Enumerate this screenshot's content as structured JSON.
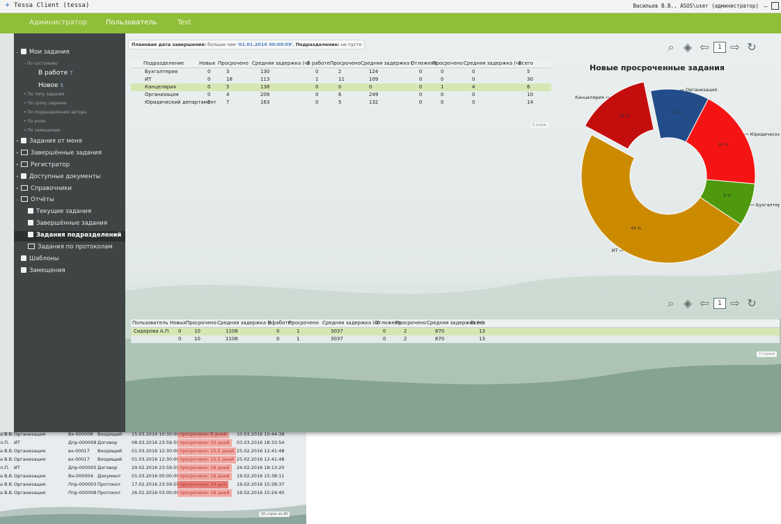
{
  "window": {
    "title": "Tessa Client (tessa)",
    "user": "Васильев В.В., ASUS\\user (администратор)"
  },
  "menu": [
    "Администратор",
    "Пользователь",
    "Test"
  ],
  "sidebar": {
    "my_tasks": "Мои задания",
    "by_state": "По состоянию",
    "in_work": "В работе",
    "in_work_count": "7",
    "new": "Новое",
    "new_count": "5",
    "subs": [
      "По типу задания",
      "По сроку задания",
      "По подразделению автора",
      "По роли",
      "По замещению"
    ],
    "items": [
      "Задания от меня",
      "Завершённые задания",
      "Регистратор",
      "Доступные документы",
      "Справочники",
      "Отчёты"
    ],
    "reports": [
      "Текущие задания",
      "Завершённые задания",
      "Задания подразделений",
      "Задания по протоколам"
    ],
    "bottom": [
      "Шаблоны",
      "Замещения"
    ]
  },
  "filter": {
    "label1": "Плановая дата завершения:",
    "cond1": "больше чем",
    "value1": "'01.01.2016 00:09:09'",
    "label2": "Подразделение:",
    "cond2": "не пусто"
  },
  "table1": {
    "headers": [
      "Подразделение",
      "Новых",
      "Просрочено",
      "Средняя задержка (ч)",
      "В работе",
      "Просрочено",
      "Средняя задержка (",
      "Отложено",
      "Просрочено",
      "Средняя задержка (ч)",
      "Всего"
    ],
    "rows": [
      [
        "Бухгалтерия",
        "0",
        "3",
        "130",
        "0",
        "2",
        "124",
        "0",
        "0",
        "0",
        "5"
      ],
      [
        "ИТ",
        "0",
        "18",
        "113",
        "1",
        "11",
        "109",
        "0",
        "0",
        "0",
        "30"
      ],
      [
        "Канцелярия",
        "0",
        "5",
        "138",
        "0",
        "0",
        "0",
        "0",
        "1",
        "4",
        "6"
      ],
      [
        "Организация",
        "0",
        "4",
        "209",
        "0",
        "6",
        "249",
        "0",
        "0",
        "0",
        "10"
      ],
      [
        "Юридический департамент",
        "2",
        "7",
        "163",
        "0",
        "5",
        "132",
        "0",
        "0",
        "0",
        "14"
      ]
    ],
    "footer": "5 строк"
  },
  "toolbar": {
    "page": "1"
  },
  "table2": {
    "headers": [
      "Пользователь",
      "Новых",
      "Просрочено",
      "Средняя задержка (ч)",
      "В работе",
      "Просрочено",
      "Средняя задержка (ч)",
      "Отложено",
      "Просрочено",
      "Средняя задержка (ч)",
      "Всего"
    ],
    "rows": [
      [
        "Сидорова А.П.",
        "0",
        "10",
        "1106",
        "0",
        "1",
        "3037",
        "0",
        "2",
        "870",
        "13"
      ]
    ],
    "total": [
      "",
      "0",
      "10",
      "1106",
      "0",
      "1",
      "3037",
      "0",
      "2",
      "870",
      "13"
    ],
    "footer": "2 строки"
  },
  "chart_data": {
    "type": "pie",
    "title": "Новые просроченные задания",
    "donut": true,
    "categories": [
      "Организация",
      "Юридический д",
      "Бухгалтерия",
      "ИТ",
      "Канцелярия"
    ],
    "values": [
      11,
      19,
      8,
      49,
      14
    ],
    "labels": [
      "11 %",
      "19 %",
      "8 %",
      "49 %",
      "14 %"
    ],
    "colors": [
      "#234d8a",
      "#f51414",
      "#4e9a0c",
      "#cc8a00",
      "#c40d0d"
    ],
    "exploded": [
      "Канцелярия"
    ]
  },
  "background_window": {
    "rows": [
      [
        "а В.В.",
        "Организация",
        "Вх-000008",
        "Входящий",
        "15.03.2016 10:30:00",
        "просрочено: 6 дней",
        "10.03.2016 10:44:38"
      ],
      [
        "л.П.",
        "ИТ",
        "Дпр-000008",
        "Договор",
        "08.03.2016 23:59:59",
        "просрочено: 10 дней",
        "03.03.2016 18:33:54"
      ],
      [
        "а В.В.",
        "Организация",
        "вх-00017",
        "Входящий",
        "01.03.2016 12:30:00",
        "просрочено: 15.5 дней",
        "25.02.2016 12:41:48"
      ],
      [
        "а В.В.",
        "Организация",
        "вх-00017",
        "Входящий",
        "01.03.2016 12:30:00",
        "просрочено: 15.5 дней",
        "25.02.2016 12:41:48"
      ],
      [
        "л.П.",
        "ИТ",
        "Дпр-000005",
        "Договор",
        "29.02.2016 23:59:59",
        "просрочено: 16 дней",
        "24.02.2016 18:13:20"
      ],
      [
        "а В.В.",
        "Организация",
        "Вн-000004",
        "Документ",
        "01.03.2016 00:00:00",
        "просрочено: 16 дней",
        "19.02.2016 15:38:11"
      ],
      [
        "а В.В.",
        "Организация",
        "Ппр-000003",
        "Протокол",
        "17.02.2016 23:59:59",
        "просрочено: 24 дня",
        "19.02.2016 15:28:37"
      ],
      [
        "а В.В.",
        "Организация",
        "Ппр-000008",
        "Протокол",
        "26.02.2016 03:00:00",
        "просрочено: 18 дней",
        "19.02.2016 15:24:40"
      ]
    ],
    "side": [
      "Б.",
      "Б.",
      "Б.",
      "П.",
      "Б.",
      "Б."
    ],
    "footer": "30 строк из 40"
  }
}
